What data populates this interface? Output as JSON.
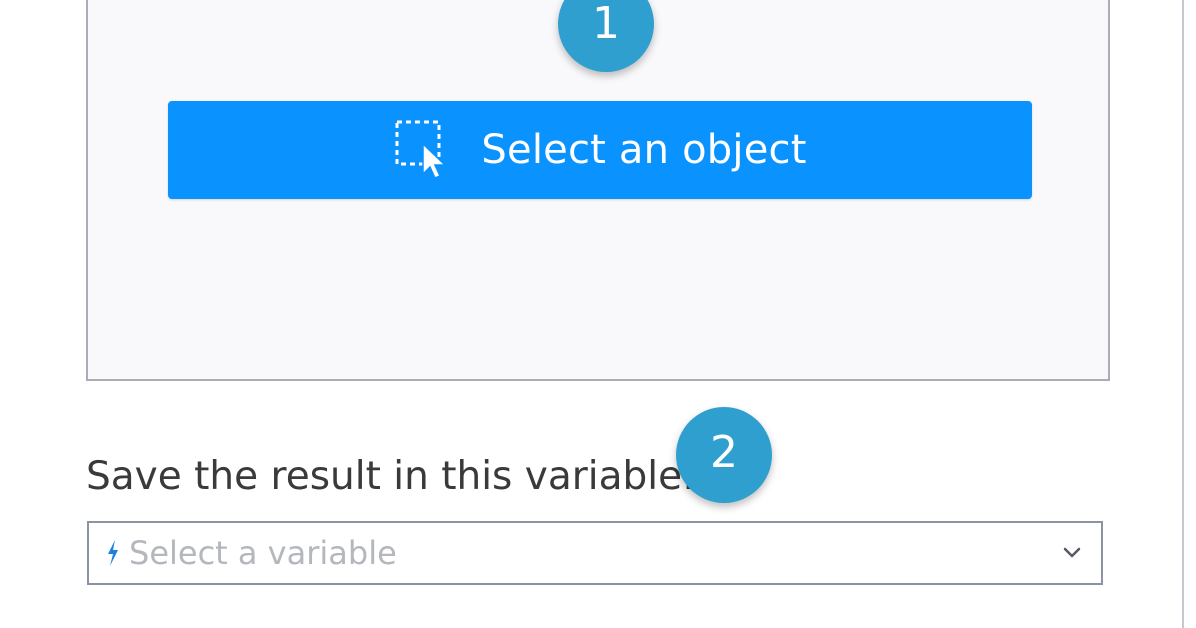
{
  "steps": {
    "step1": "1",
    "step2": "2"
  },
  "object_picker": {
    "button_label": "Select an object",
    "icon": "select-object-icon"
  },
  "result_variable": {
    "label": "Save the result in this variable:",
    "placeholder": "Select a variable",
    "prefix_icon": "bolt-icon",
    "dropdown_icon": "chevron-down-icon"
  },
  "colors": {
    "badge": "#2f9fd0",
    "button": "#0a93ff",
    "panel_bg": "#f9f9fb",
    "panel_border": "#a9adb8",
    "input_border": "#8c93a2",
    "placeholder_text": "#b4b7bd",
    "bolt": "#1e7fe0"
  }
}
